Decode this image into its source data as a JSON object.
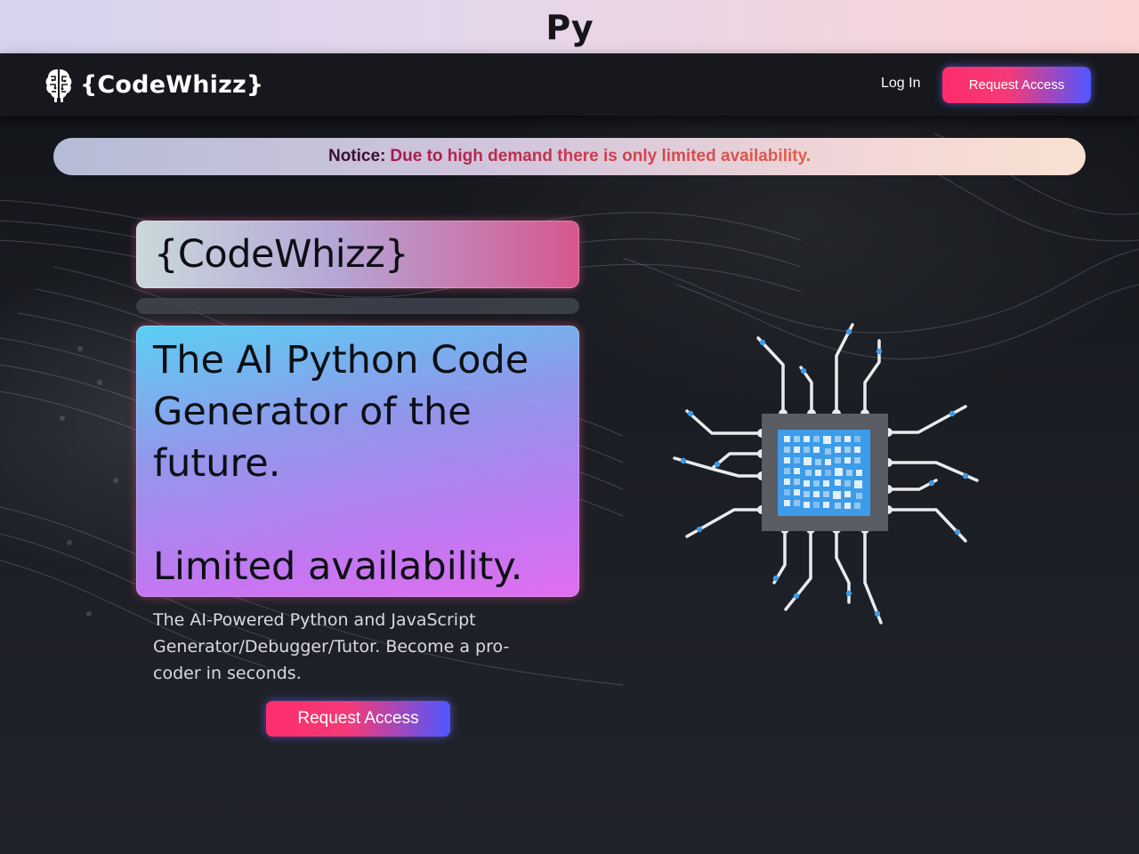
{
  "top_strip": {
    "text": "Py"
  },
  "navbar": {
    "brand": "{CodeWhizz}",
    "login": "Log In",
    "request_access": "Request Access"
  },
  "notice": {
    "label": "Notice:",
    "text": "Due to high demand there is only limited availability."
  },
  "hero": {
    "title": "{CodeWhizz}",
    "headline": "The AI Python Code Generator of the future.",
    "headline_2": "Limited availability.",
    "description": "The AI-Powered Python and JavaScript Generator/Debugger/Tutor. Become a pro-coder in seconds.",
    "cta": "Request Access"
  },
  "colors": {
    "accent_pink": "#ff2d6b",
    "accent_blue": "#4f57ff",
    "nav_bg": "#16181d",
    "chip_blue": "#3d9be9"
  },
  "icons": {
    "brand_logo": "brain-circuit-icon",
    "illustration": "microchip-icon"
  }
}
